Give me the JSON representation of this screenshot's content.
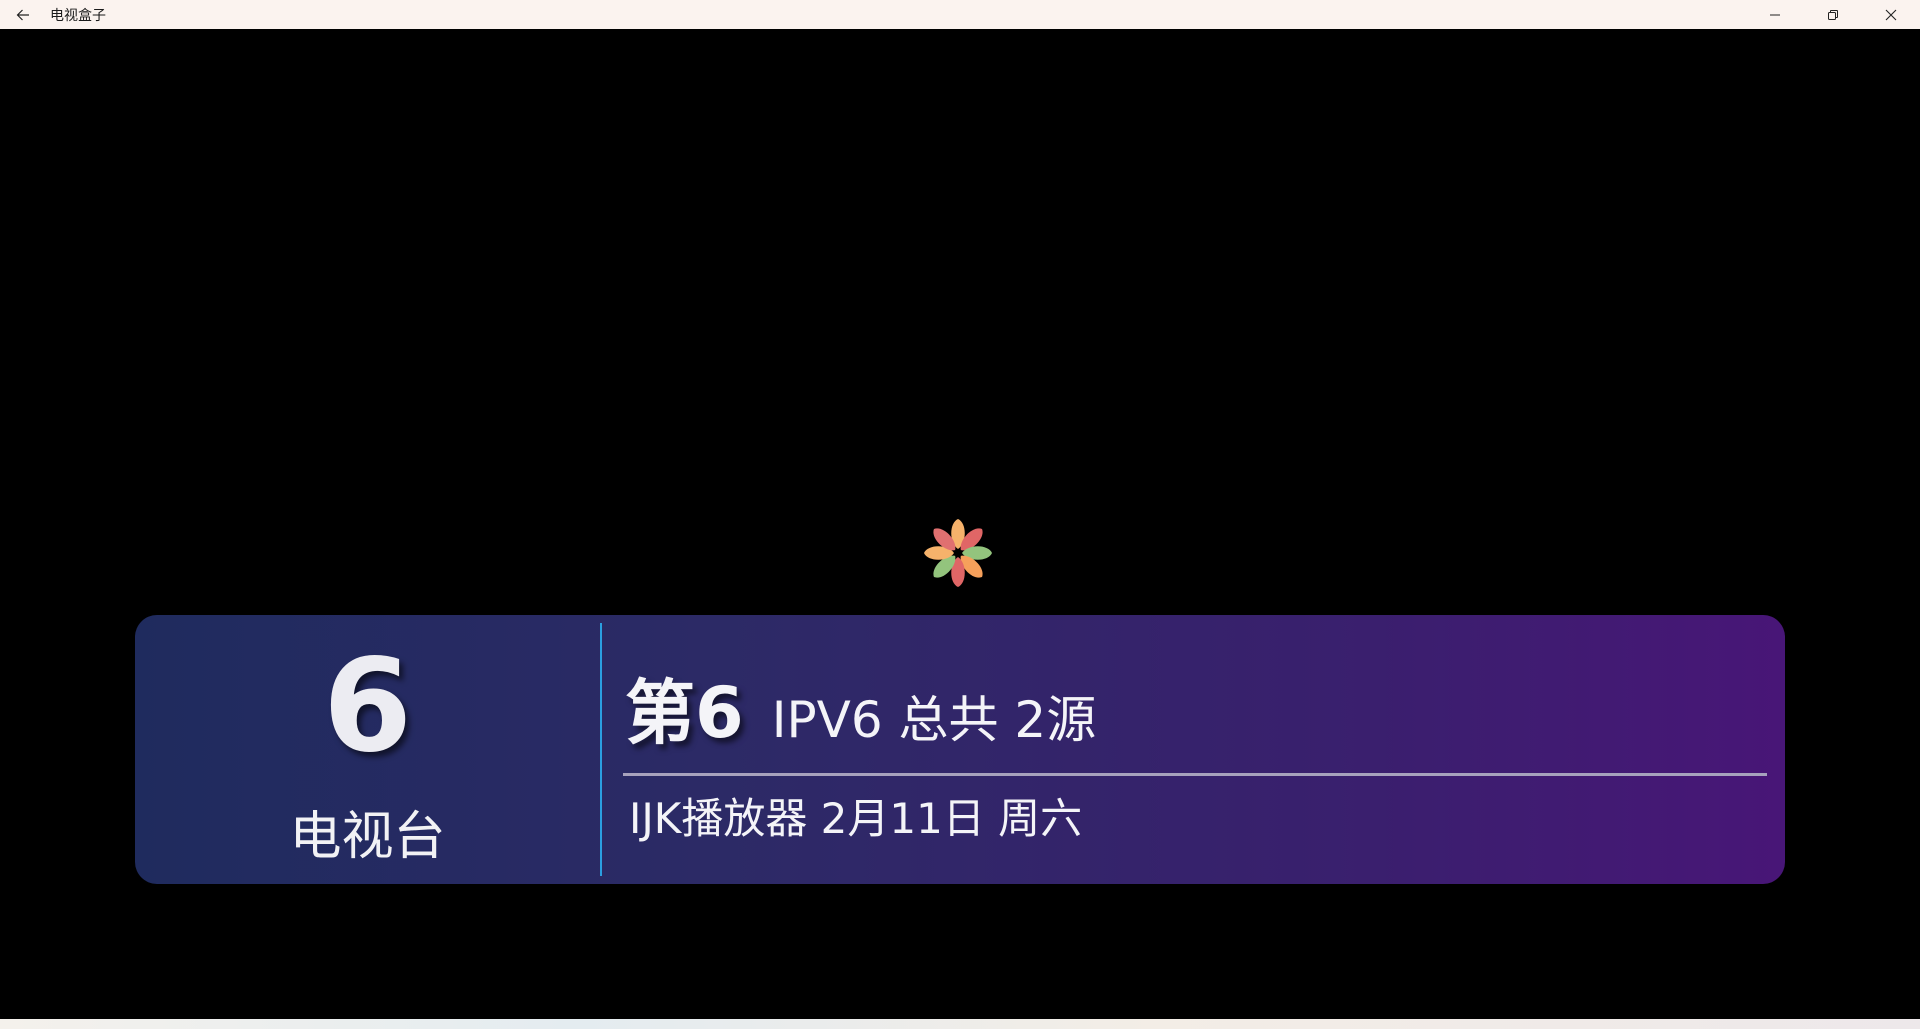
{
  "window": {
    "title": "电视盒子",
    "back_icon": "arrow-left-icon",
    "minimize_icon": "minimize-icon",
    "restore_icon": "restore-icon",
    "close_icon": "close-icon"
  },
  "player": {
    "loading_icon": "flower-spinner-icon",
    "spinner_colors": [
      "#f6b26b",
      "#e06666",
      "#93c47d",
      "#f6a05b",
      "#e06666",
      "#93c47d",
      "#f6b26b",
      "#e07070"
    ]
  },
  "info_panel": {
    "channel_number": "6",
    "channel_name": "电视台",
    "program_prefix": "第6",
    "program_detail": "IPV6 总共 2源",
    "meta": "IJK播放器 2月11日 周六",
    "accent_color": "#2b9fe0",
    "gradient_start": "#1f2b5e",
    "gradient_end": "#481677"
  }
}
